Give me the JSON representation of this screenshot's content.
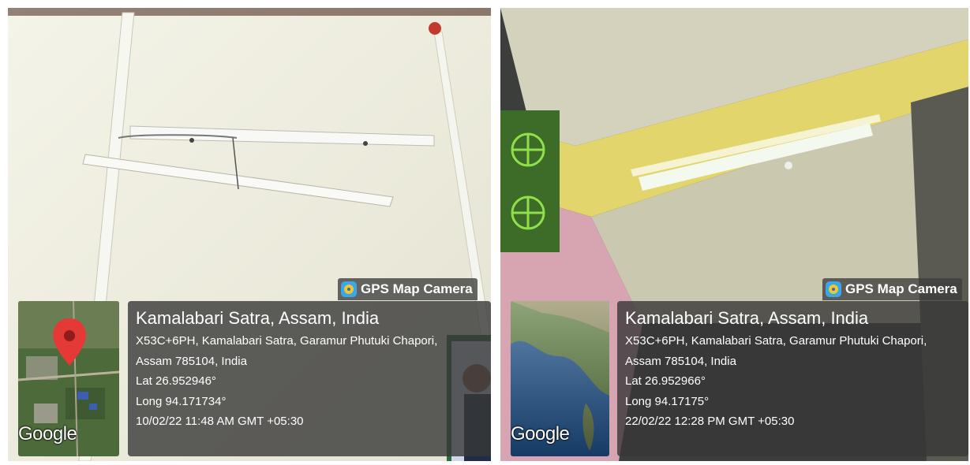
{
  "photos": [
    {
      "badge": "GPS Map Camera",
      "place": "Kamalabari Satra, Assam, India",
      "address_line1": "X53C+6PH, Kamalabari Satra, Garamur Phutuki Chapori,",
      "address_line2": "Assam 785104, India",
      "lat": "Lat 26.952946°",
      "long": "Long 94.171734°",
      "datetime": "10/02/22 11:48 AM GMT +05:30",
      "map_brand": "Google",
      "map_icon": "map-pin-icon"
    },
    {
      "badge": "GPS Map Camera",
      "place": "Kamalabari Satra, Assam, India",
      "address_line1": "X53C+6PH, Kamalabari Satra, Garamur Phutuki Chapori,",
      "address_line2": "Assam 785104, India",
      "lat": "Lat 26.952966°",
      "long": "Long 94.17175°",
      "datetime": "22/02/22 12:28 PM GMT +05:30",
      "map_brand": "Google",
      "map_icon": "satellite-globe-icon"
    }
  ],
  "colors": {
    "overlay": "#373737",
    "pin": "#e53935",
    "wall_left": "#efeedd",
    "ceiling_right": "#cfcdb6",
    "beam_yellow": "#e4d66a",
    "wall_pink": "#d8a7b4",
    "vent_green": "#5fb82c"
  }
}
